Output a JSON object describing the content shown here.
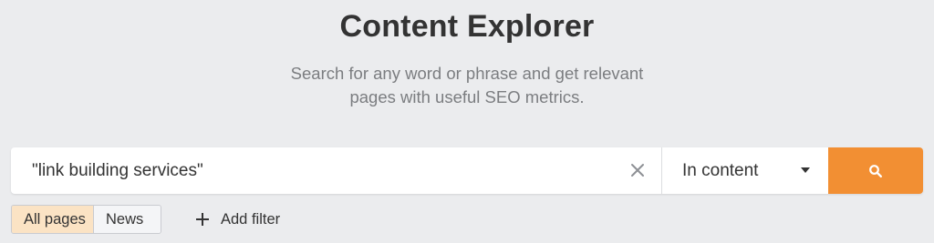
{
  "header": {
    "title": "Content Explorer",
    "subtitle_line1": "Search for any word or phrase and get relevant",
    "subtitle_line2": "pages with useful SEO metrics."
  },
  "search": {
    "value": "\"link building services\"",
    "mode_selected": "In content",
    "clear_icon": "close-icon",
    "submit_icon": "search-icon",
    "accent_color": "#f28f33"
  },
  "filters": {
    "tabs": [
      {
        "label": "All pages",
        "active": true
      },
      {
        "label": "News",
        "active": false
      }
    ],
    "add_filter_label": "Add filter",
    "add_filter_icon": "plus-icon",
    "active_tab_color": "#fbe3c4"
  }
}
